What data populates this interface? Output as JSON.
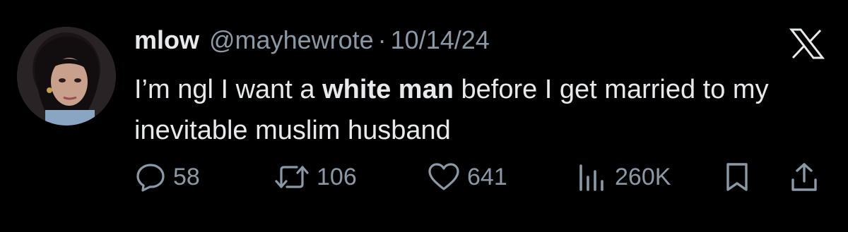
{
  "tweet": {
    "display_name": "mlow",
    "handle": "@mayhewrote",
    "separator": "·",
    "date": "10/14/24",
    "text_part1": "I’m ngl I want a ",
    "text_bold": "white man",
    "text_part2": " before I get married to my inevitable muslim husband"
  },
  "actions": {
    "replies": "58",
    "reposts": "106",
    "likes": "641",
    "views": "260K"
  },
  "icons": {
    "brand": "x-logo-icon",
    "reply": "reply-icon",
    "repost": "repost-icon",
    "like": "heart-icon",
    "views": "views-icon",
    "bookmark": "bookmark-icon",
    "share": "share-icon"
  },
  "colors": {
    "background": "#000000",
    "text_primary": "#e7e9ea",
    "text_secondary": "#8b98a5"
  }
}
